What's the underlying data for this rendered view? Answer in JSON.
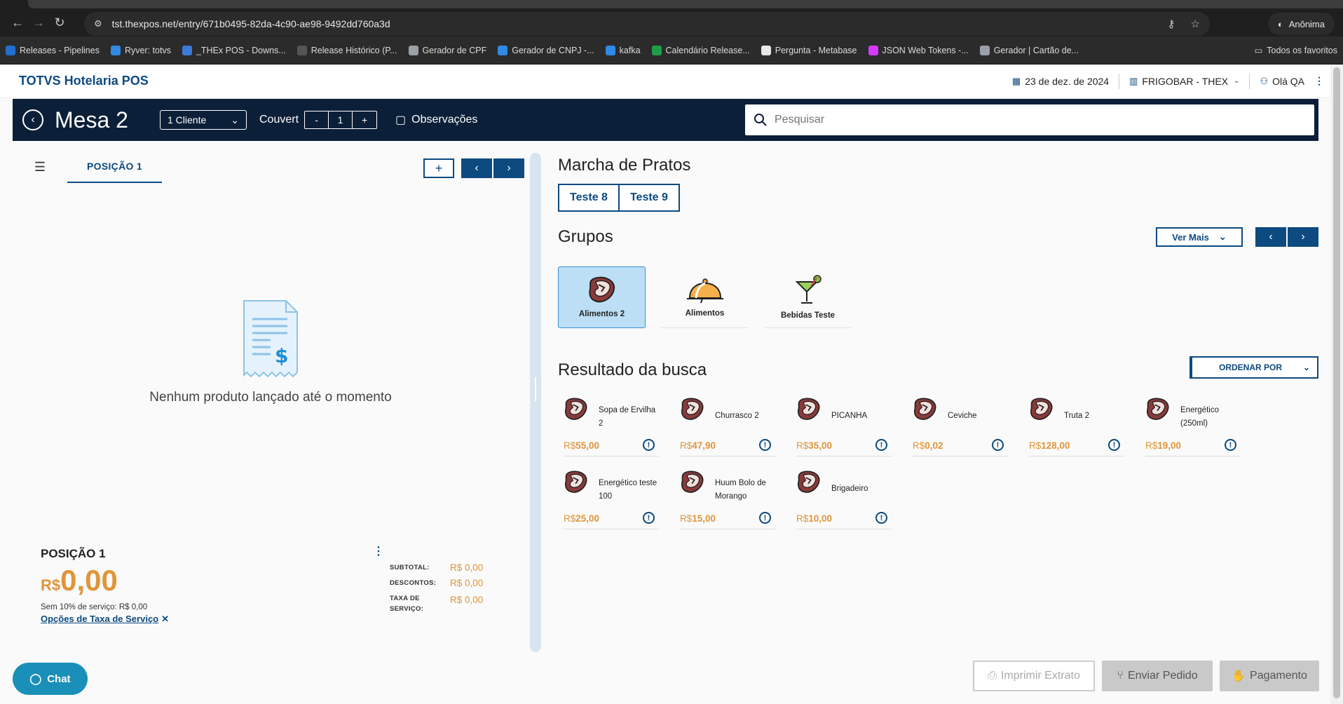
{
  "browser": {
    "url": "tst.thexpos.net/entry/671b0495-82da-4c90-ae98-9492dd760a3d",
    "profile": "Anônima",
    "bookmarks": [
      {
        "label": "Releases - Pipelines",
        "color": "#1f6fd1"
      },
      {
        "label": "Ryver: totvs",
        "color": "#2f8ae6"
      },
      {
        "label": "_THEx POS - Downs...",
        "color": "#3b7bd8"
      },
      {
        "label": "Release Histórico (P...",
        "color": "#555555"
      },
      {
        "label": "Gerador de CPF",
        "color": "#9aa0a6"
      },
      {
        "label": "Gerador de CNPJ -...",
        "color": "#2f8ae6"
      },
      {
        "label": "kafka",
        "color": "#2f8ae6"
      },
      {
        "label": "Calendário Release...",
        "color": "#1e9e4a"
      },
      {
        "label": "Pergunta - Metabase",
        "color": "#e8e8e8"
      },
      {
        "label": "JSON Web Tokens -...",
        "color": "#d63aff"
      },
      {
        "label": "Gerador | Cartão de...",
        "color": "#9aa0a6"
      }
    ],
    "all_bookmarks": "Todos os favoritos"
  },
  "app": {
    "brand": "TOTVS Hotelaria POS",
    "date": "23 de dez. de 2024",
    "location": "FRIGOBAR - THEX",
    "user": "Olá QA"
  },
  "header": {
    "table_name": "Mesa 2",
    "clients": "1 Cliente",
    "couvert_label": "Couvert",
    "couvert_minus": "-",
    "couvert_value": "1",
    "couvert_plus": "+",
    "observations": "Observações",
    "search_placeholder": "Pesquisar"
  },
  "left": {
    "tab_label": "POSIÇÃO 1",
    "add_label": "+",
    "empty_message": "Nenhum produto lançado até o momento",
    "summary": {
      "title": "POSIÇÃO 1",
      "currency": "R$",
      "total": "0,00",
      "service_note": "Sem 10% de serviço: R$ 0,00",
      "service_link": "Opções de Taxa de Serviço",
      "subtotal_label": "SUBTOTAL:",
      "subtotal_value": "R$ 0,00",
      "discounts_label": "DESCONTOS:",
      "discounts_value": "R$ 0,00",
      "service_label": "TAXA DE SERVIÇO:",
      "service_value": "R$ 0,00"
    }
  },
  "right": {
    "marcha_title": "Marcha de Pratos",
    "marcha_items": [
      "Teste 8",
      "Teste 9"
    ],
    "grupos_title": "Grupos",
    "ver_mais": "Ver Mais",
    "groups": [
      {
        "label": "Alimentos 2",
        "icon": "steak-icon",
        "selected": true
      },
      {
        "label": "Alimentos",
        "icon": "cloche-icon",
        "selected": false
      },
      {
        "label": "Bebidas Teste",
        "icon": "cocktail-icon",
        "selected": false
      }
    ],
    "results_title": "Resultado da busca",
    "order_by": "ORDENAR POR",
    "products": [
      {
        "name": "Sopa de Ervilha 2",
        "currency": "R$",
        "price": "55,00"
      },
      {
        "name": "Churrasco 2",
        "currency": "R$",
        "price": "47,90"
      },
      {
        "name": "PICANHA",
        "currency": "R$",
        "price": "35,00"
      },
      {
        "name": "Ceviche",
        "currency": "R$",
        "price": "0,02"
      },
      {
        "name": "Truta 2",
        "currency": "R$",
        "price": "128,00"
      },
      {
        "name": "Energético (250ml)",
        "currency": "R$",
        "price": "19,00"
      },
      {
        "name": "Energético teste 100",
        "currency": "R$",
        "price": "25,00"
      },
      {
        "name": "Huum Bolo de Morango",
        "currency": "R$",
        "price": "15,00"
      },
      {
        "name": "Brigadeiro",
        "currency": "R$",
        "price": "10,00"
      }
    ]
  },
  "footer": {
    "print": "Imprimir Extrato",
    "send": "Enviar Pedido",
    "pay": "Pagamento",
    "chat": "Chat"
  },
  "colors": {
    "primary": "#0c4a80",
    "header_bg": "#0b1f38",
    "price": "#e0953a",
    "chat": "#1a90b9"
  }
}
